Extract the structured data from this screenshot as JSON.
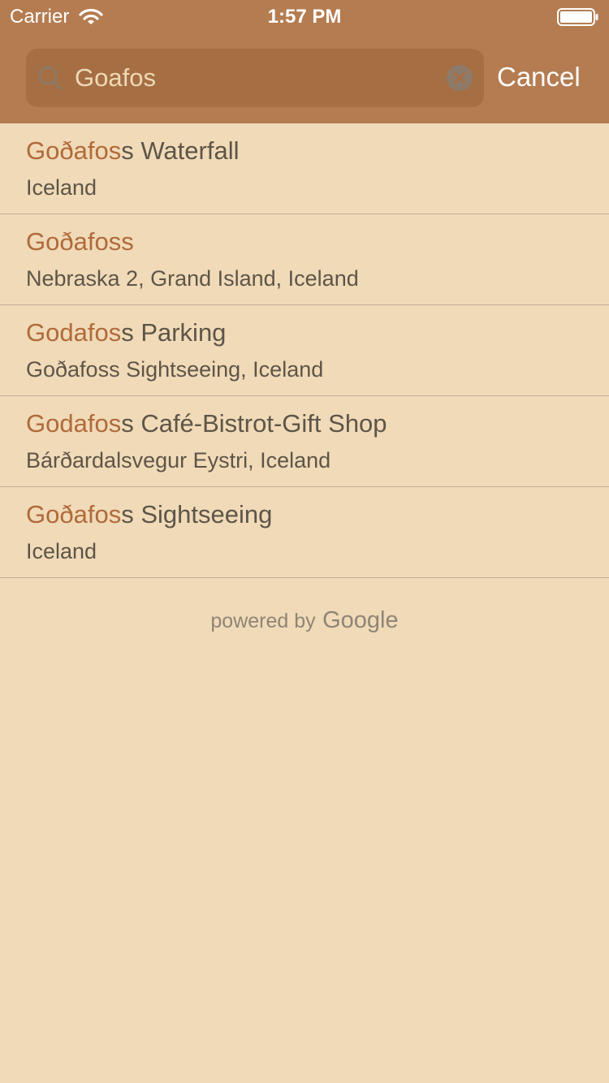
{
  "status_bar": {
    "carrier": "Carrier",
    "time": "1:57 PM",
    "icons": [
      "wifi-icon",
      "battery-icon"
    ]
  },
  "search": {
    "value": "Goafos",
    "placeholder": "",
    "clear_icon": "clear-icon",
    "search_icon": "search-icon",
    "cancel_label": "Cancel"
  },
  "results": [
    {
      "title_match": "Goðafos",
      "title_rest": "s Waterfall",
      "subtitle": "Iceland"
    },
    {
      "title_match": "Goðafoss",
      "title_rest": "",
      "subtitle": "Nebraska 2, Grand Island, Iceland"
    },
    {
      "title_match": "Godafos",
      "title_rest": "s Parking",
      "subtitle": "Goðafoss Sightseeing, Iceland"
    },
    {
      "title_match": "Godafos",
      "title_rest": "s Café-Bistrot-Gift Shop",
      "subtitle": "Bárðardalsvegur Eystri, Iceland"
    },
    {
      "title_match": "Goðafos",
      "title_rest": "s Sightseeing",
      "subtitle": "Iceland"
    }
  ],
  "attribution": {
    "prefix": "powered by",
    "brand": "Google"
  },
  "colors": {
    "header": "#B47C50",
    "background": "#F0DAB8",
    "match_highlight": "#B06A3A",
    "text": "#5E5548"
  }
}
